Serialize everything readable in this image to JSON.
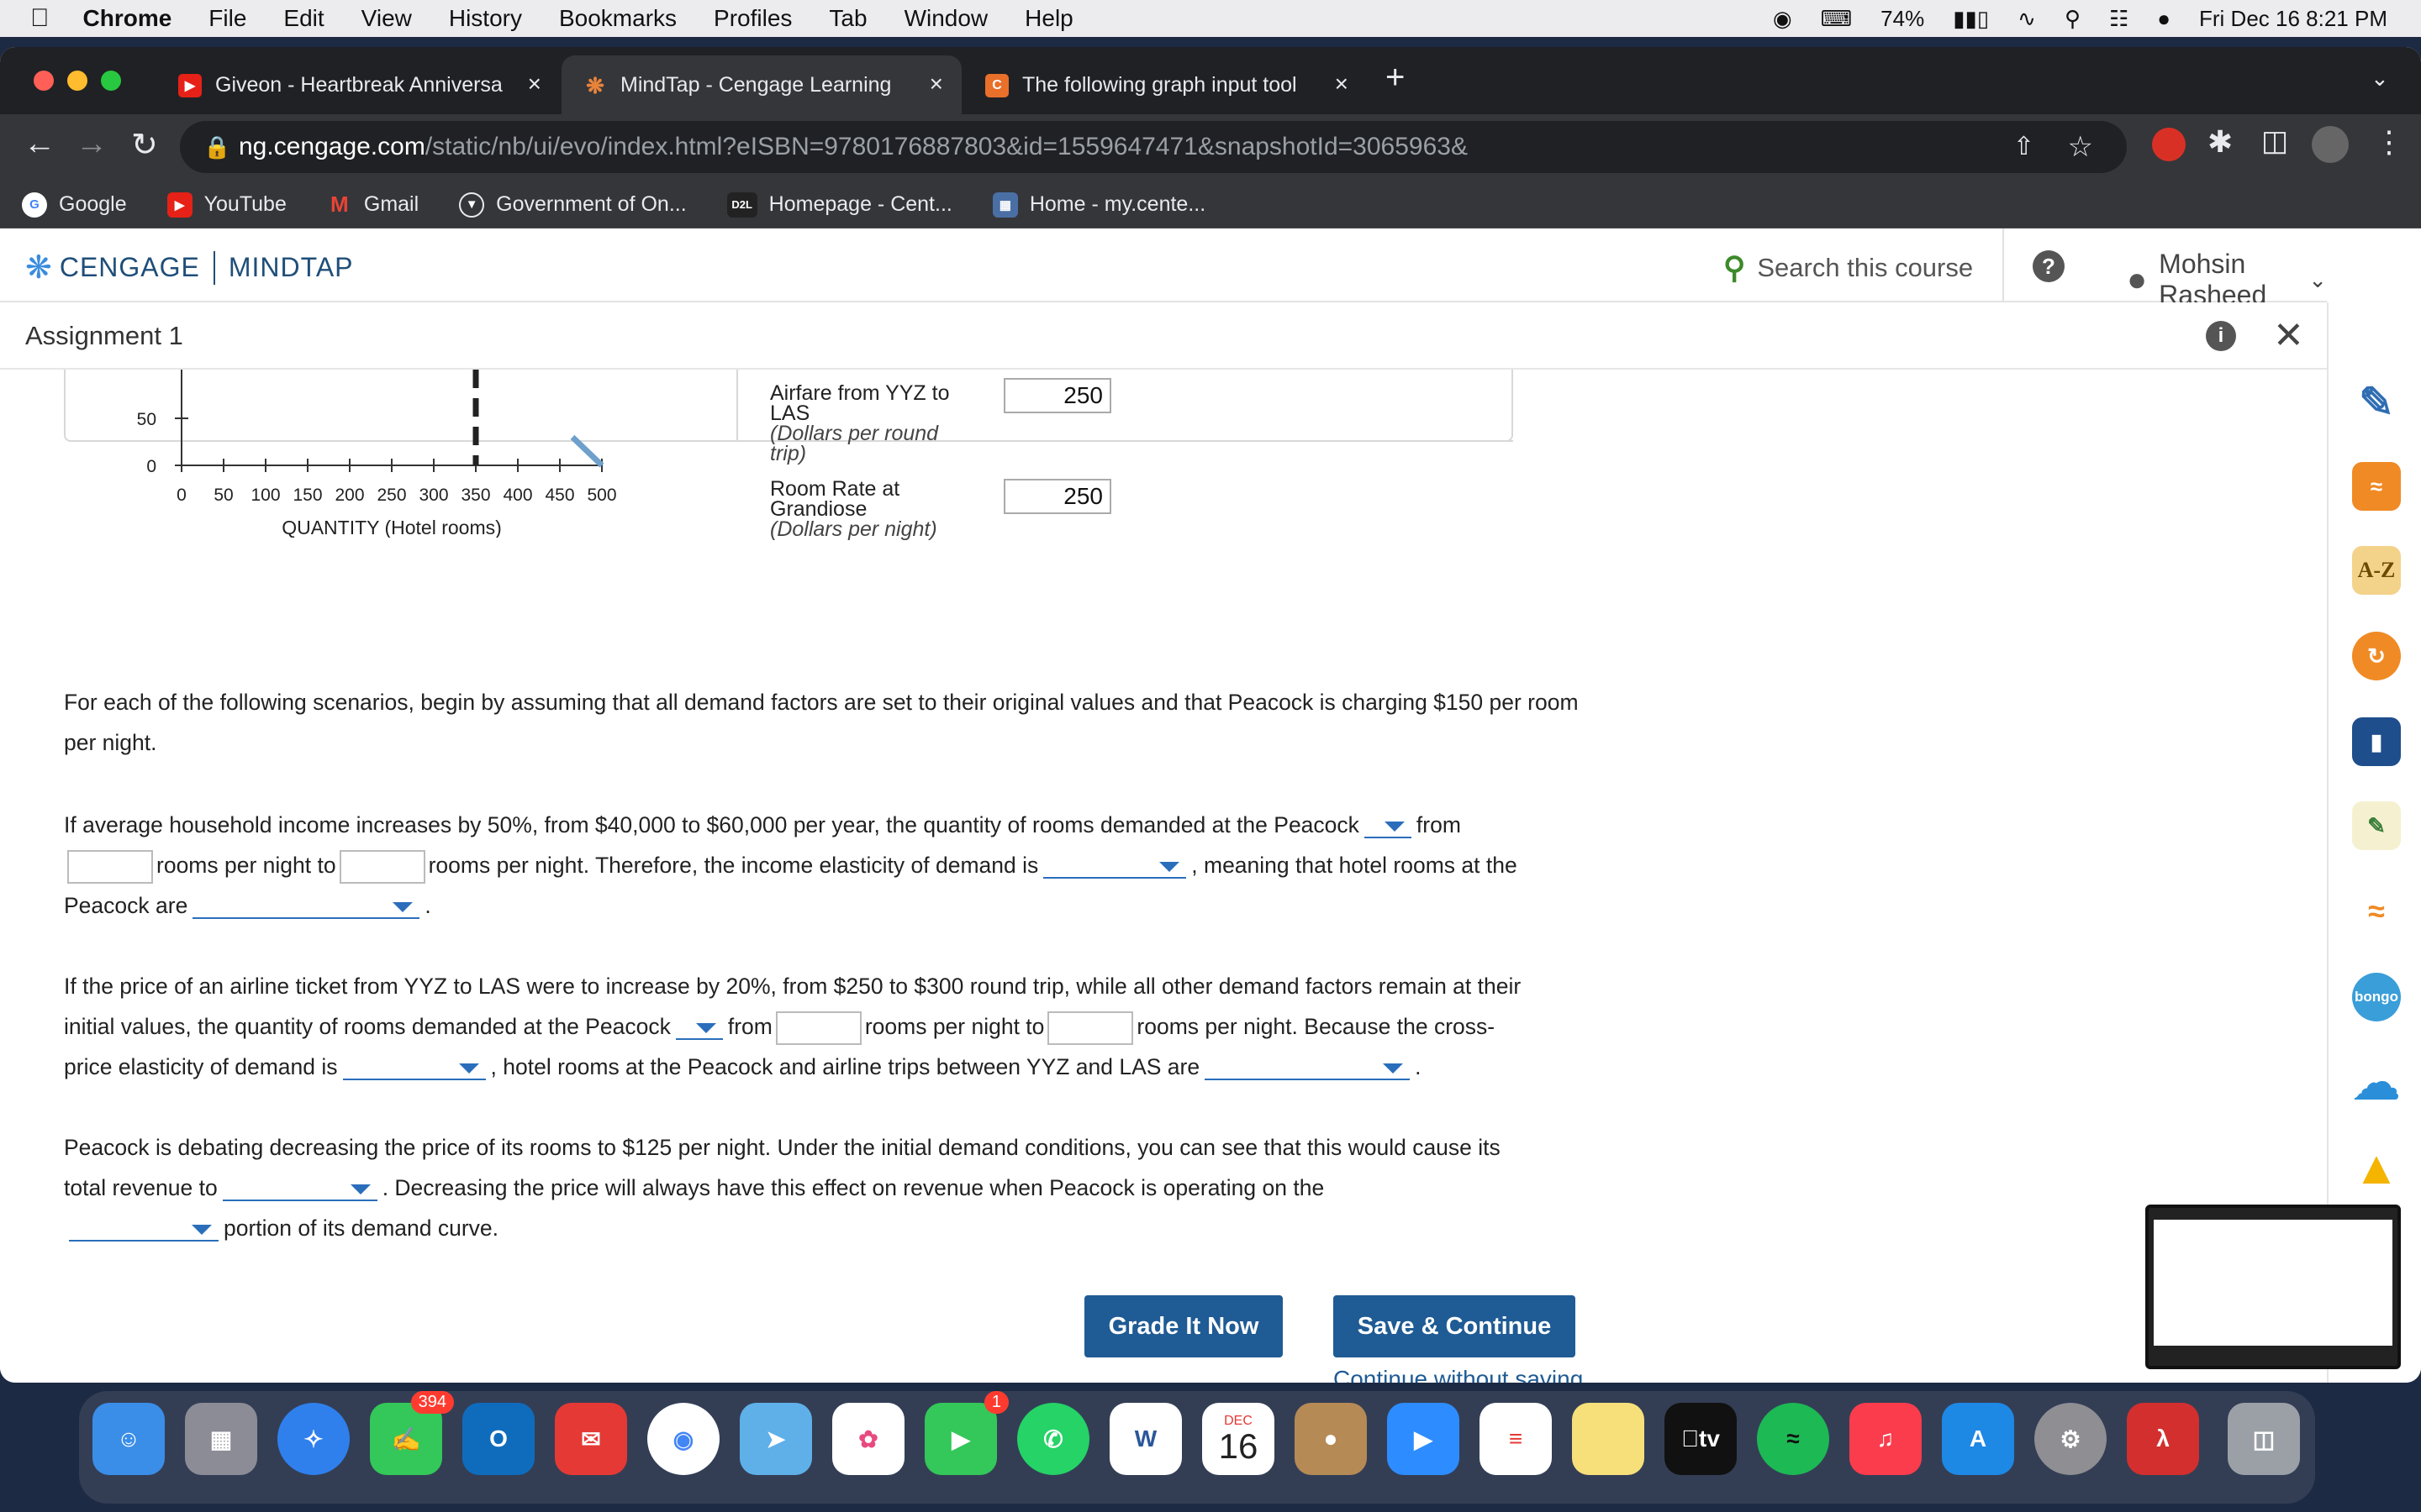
{
  "menubar": {
    "app": "Chrome",
    "items": [
      "File",
      "Edit",
      "View",
      "History",
      "Bookmarks",
      "Profiles",
      "Tab",
      "Window",
      "Help"
    ],
    "battery": "74%",
    "datetime": "Fri Dec 16  8:21 PM"
  },
  "tabs": [
    {
      "title": "Giveon - Heartbreak Anniversa",
      "close": "×"
    },
    {
      "title": "MindTap - Cengage Learning",
      "close": "×"
    },
    {
      "title": "The following graph input tool",
      "close": "×"
    }
  ],
  "new_tab": "+",
  "address": {
    "host": "ng.cengage.com",
    "path": "/static/nb/ui/evo/index.html?eISBN=9780176887803&id=1559647471&snapshotId=3065963&"
  },
  "bookmarks": [
    "Google",
    "YouTube",
    "Gmail",
    "Government of On...",
    "Homepage - Cent...",
    "Home - my.cente..."
  ],
  "header": {
    "brand_left": "CENGAGE",
    "brand_right": "MINDTAP",
    "search_label": "Search this course",
    "help": "?",
    "user_name": "Mohsin Rasheed"
  },
  "assignment": {
    "title": "Assignment 1"
  },
  "chart_data": {
    "type": "line",
    "xlabel": "QUANTITY (Hotel rooms)",
    "x_ticks": [
      0,
      50,
      100,
      150,
      200,
      250,
      300,
      350,
      400,
      450,
      500
    ],
    "y_ticks_visible": [
      50,
      0
    ],
    "xlim": [
      0,
      500
    ],
    "ylim": [
      0,
      50
    ],
    "series": [
      {
        "values": [
          [
            465,
            30
          ],
          [
            500,
            0
          ]
        ]
      }
    ],
    "marker_x": 350
  },
  "inputs": [
    {
      "label": "Airfare from YYZ to LAS",
      "unit": "(Dollars per round trip)",
      "value": "250"
    },
    {
      "label": "Room Rate at Grandiose",
      "unit": "(Dollars per night)",
      "value": "250"
    }
  ],
  "text": {
    "intro": "For each of the following scenarios, begin by assuming that all demand factors are set to their original values and that Peacock is charging $150 per room per night.",
    "s1a": "If average household income increases by 50%, from $40,000 to $60,000 per year, the quantity of rooms demanded at the Peacock",
    "s1b": "from",
    "s1c": "rooms per night to",
    "s1d": "rooms per night. Therefore, the income elasticity of demand is",
    "s1e": ", meaning that hotel rooms at the",
    "s1f": "Peacock are",
    "s1g": ".",
    "s2a": "If the price of an airline ticket from YYZ to LAS were to increase by 20%, from $250 to $300 round trip, while all other demand factors remain at their",
    "s2b": "initial values, the quantity of rooms demanded at the Peacock",
    "s2c": "from",
    "s2d": "rooms per night to",
    "s2e": "rooms per night. Because the cross-",
    "s2f": "price elasticity of demand is",
    "s2g": ", hotel rooms at the Peacock and airline trips between YYZ and LAS are",
    "s2h": ".",
    "s3a": "Peacock is debating decreasing the price of its rooms to $125 per night. Under the initial demand conditions, you can see that this would cause its",
    "s3b": "total revenue to",
    "s3c": ". Decreasing the price will always have this effect on revenue when Peacock is operating on the",
    "s3d": "portion of its demand curve."
  },
  "buttons": {
    "grade": "Grade It Now",
    "save": "Save & Continue",
    "continue": "Continue without saving"
  },
  "dock": {
    "messages_badge": "394",
    "facetime_badge": "1",
    "calendar_month": "DEC",
    "calendar_day": "16",
    "tv_label": "tv",
    "word": "W"
  },
  "colors": {
    "accent": "#1f5b94",
    "dropdown": "#2a6ebb",
    "curve": "#6fa0cc"
  }
}
